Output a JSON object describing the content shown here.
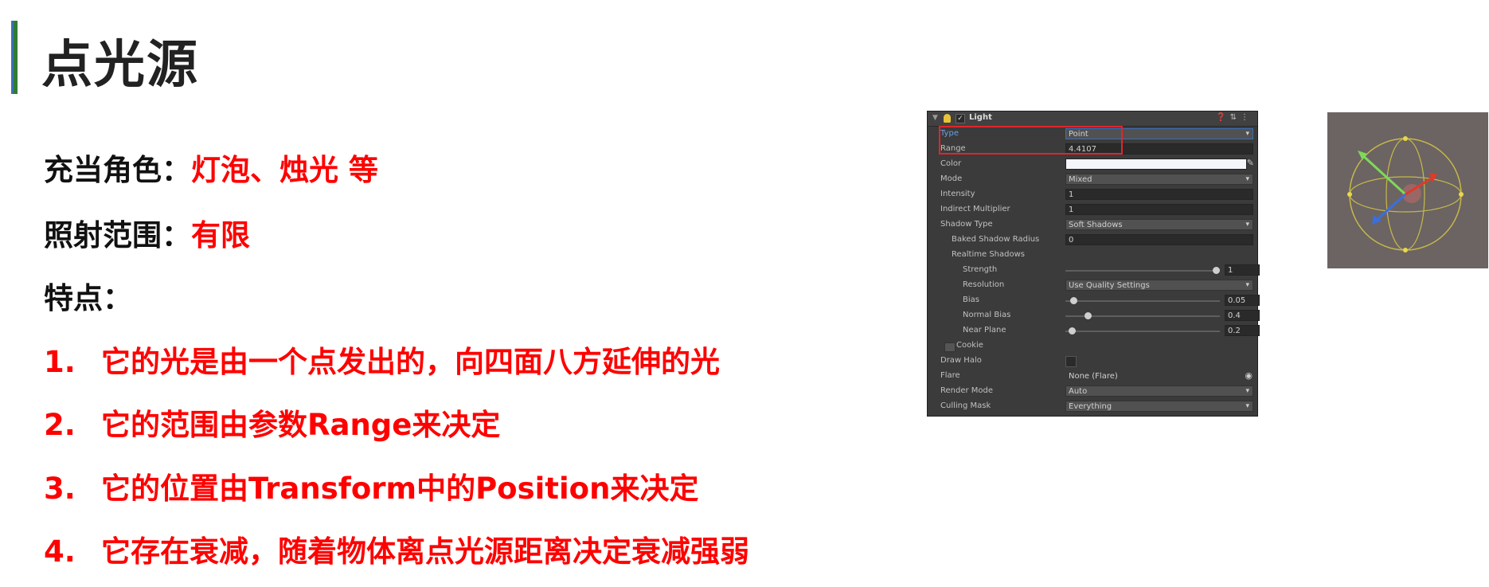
{
  "slide": {
    "title": "点光源",
    "role_label": "充当角色：",
    "role_value": "灯泡、烛光 等",
    "range_label": "照射范围：",
    "range_value": "有限",
    "features_label": "特点：",
    "items": [
      {
        "num": "1.",
        "text": "它的光是由一个点发出的，向四面八方延伸的光"
      },
      {
        "num": "2.",
        "text": "它的范围由参数Range来决定"
      },
      {
        "num": "3.",
        "text": "它的位置由Transform中的Position来决定"
      },
      {
        "num": "4.",
        "text": "它存在衰减，随着物体离点光源距离决定衰减强弱"
      }
    ]
  },
  "inspector": {
    "component": "Light",
    "enabled": true,
    "rows": [
      {
        "label": "Type",
        "value": "Point",
        "kind": "dropdown"
      },
      {
        "label": "Range",
        "value": "4.4107",
        "kind": "field"
      },
      {
        "label": "Color",
        "value": "",
        "kind": "color"
      },
      {
        "label": "Mode",
        "value": "Mixed",
        "kind": "dropdown"
      },
      {
        "label": "Intensity",
        "value": "1",
        "kind": "field"
      },
      {
        "label": "Indirect Multiplier",
        "value": "1",
        "kind": "field"
      },
      {
        "label": "Shadow Type",
        "value": "Soft Shadows",
        "kind": "dropdown"
      },
      {
        "label": "Baked Shadow Radius",
        "value": "0",
        "kind": "field"
      },
      {
        "label": "Realtime Shadows",
        "value": "",
        "kind": "header"
      },
      {
        "label": "Strength",
        "value": "1",
        "kind": "slider",
        "fraction": 1.0
      },
      {
        "label": "Resolution",
        "value": "Use Quality Settings",
        "kind": "dropdown"
      },
      {
        "label": "Bias",
        "value": "0.05",
        "kind": "slider",
        "fraction": 0.03
      },
      {
        "label": "Normal Bias",
        "value": "0.4",
        "kind": "slider",
        "fraction": 0.13
      },
      {
        "label": "Near Plane",
        "value": "0.2",
        "kind": "slider",
        "fraction": 0.02
      },
      {
        "label": "Cookie",
        "value": "",
        "kind": "cookie"
      },
      {
        "label": "Draw Halo",
        "value": "",
        "kind": "checkbox"
      },
      {
        "label": "Flare",
        "value": "None (Flare)",
        "kind": "object"
      },
      {
        "label": "Render Mode",
        "value": "Auto",
        "kind": "dropdown"
      },
      {
        "label": "Culling Mask",
        "value": "Everything",
        "kind": "dropdown"
      }
    ]
  },
  "colors": {
    "accent_red": "#ff0000",
    "title_bar_green": "#2e7d32",
    "highlight_red": "#e0262a"
  }
}
